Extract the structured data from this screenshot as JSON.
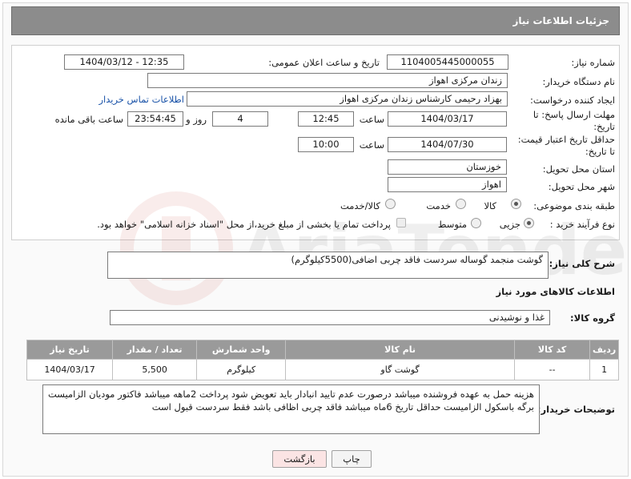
{
  "header": {
    "title": "جزئیات اطلاعات نیاز"
  },
  "form": {
    "need_number_label": "شماره نیاز:",
    "need_number": "1104005445000055",
    "announce_label": "تاریخ و ساعت اعلان عمومی:",
    "announce_value": "1404/03/12 - 12:35",
    "buyer_label": "نام دستگاه خریدار:",
    "buyer_value": "زندان مرکزی اهواز",
    "creator_label": "ایجاد کننده درخواست:",
    "creator_value": "بهزاد رحیمی کارشناس زندان مرکزی اهواز",
    "contact_link": "اطلاعات تماس خریدار",
    "deadline_label_1": "مهلت ارسال پاسخ: تا",
    "deadline_label_2": "تاریخ:",
    "deadline_date": "1404/03/17",
    "time_label": "ساعت",
    "deadline_time": "12:45",
    "days_value": "4",
    "days_label": "روز و",
    "remaining_time": "23:54:45",
    "remaining_label": "ساعت باقی مانده",
    "validity_label_1": "حداقل تاریخ اعتبار قیمت:",
    "validity_label_2": "تا تاریخ:",
    "validity_date": "1404/07/30",
    "validity_time": "10:00",
    "province_label": "استان محل تحویل:",
    "province_value": "خوزستان",
    "city_label": "شهر محل تحویل:",
    "city_value": "اهواز",
    "category_label": "طبقه بندی موضوعی:",
    "category_options": [
      "کالا",
      "خدمت",
      "کالا/خدمت"
    ],
    "category_selected": "کالا",
    "process_label": "نوع فرآیند خرید :",
    "process_options": [
      "جزیی",
      "متوسط"
    ],
    "process_selected": "جزیی",
    "payment_note": "پرداخت تمام یا بخشی از مبلغ خرید،از محل \"اسناد خزانه اسلامی\" خواهد بود."
  },
  "description": {
    "label": "شرح کلی نیاز:",
    "value": "گوشت منجمد گوساله سردست فاقد چربی اضافی(5500کیلوگرم)"
  },
  "goods": {
    "section_title": "اطلاعات کالاهای مورد نیاز",
    "group_label": "گروه کالا:",
    "group_value": "غذا و نوشیدنی",
    "columns": [
      "ردیف",
      "کد کالا",
      "نام کالا",
      "واحد شمارش",
      "تعداد / مقدار",
      "تاریخ نیاز"
    ],
    "rows": [
      {
        "row": "1",
        "code": "--",
        "name": "گوشت گاو",
        "unit": "کیلوگرم",
        "qty": "5,500",
        "date": "1404/03/17"
      }
    ]
  },
  "notes": {
    "label": "توضیحات خریدار:",
    "value": "هزینه حمل به عهده فروشنده میباشد درصورت عدم تایید انبادار باید تعویض شود پرداخت 2ماهه میباشد فاکتور مودیان الزامیست برگه باسکول الزامیست حداقل تاریخ 6ماه میباشد فاقد چربی اظافی باشد فقط سردست قبول است"
  },
  "buttons": {
    "print": "چاپ",
    "back": "بازگشت"
  },
  "watermark": {
    "text": "AriaTender.neT"
  },
  "colors": {
    "header_bg": "#8c8c8c",
    "table_header_bg": "#9a9a9a",
    "link": "#1a53a8",
    "back_button_bg": "#fbe4e4"
  }
}
